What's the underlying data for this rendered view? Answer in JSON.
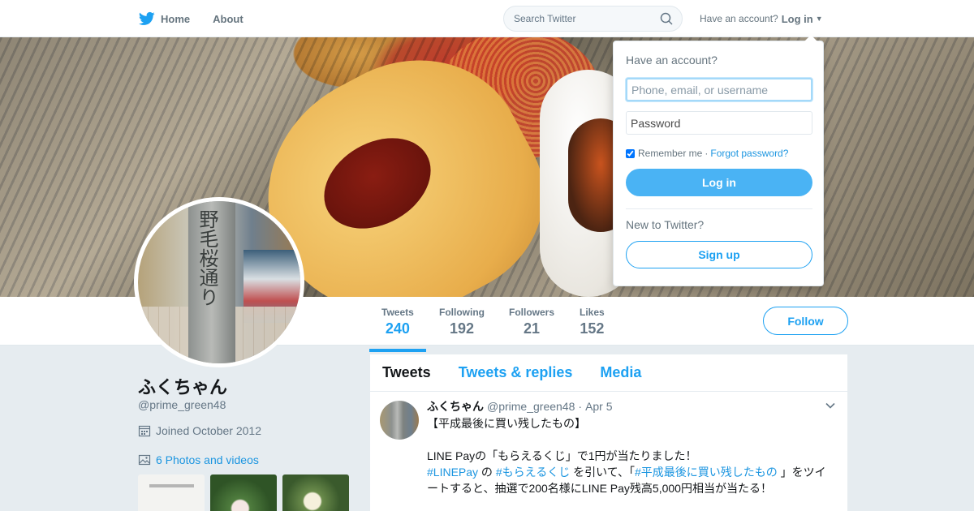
{
  "nav": {
    "home_label": "Home",
    "about_label": "About",
    "search_placeholder": "Search Twitter",
    "have_account_prompt": "Have an account?",
    "login_toggle_label": "Log in"
  },
  "colors": {
    "accent": "#1da1f2",
    "link": "#1b95e0",
    "login_button": "#4ab3f4",
    "background": "#e6ecf0"
  },
  "icons": {
    "brand": "twitter-bird-icon",
    "search": "search-icon",
    "caret": "caret-down-icon",
    "calendar": "calendar-icon",
    "photo": "photo-icon",
    "tweet_menu": "chevron-down-icon"
  },
  "login_dropdown": {
    "title": "Have an account?",
    "username_placeholder": "Phone, email, or username",
    "password_placeholder": "Password",
    "remember_label": "Remember me",
    "remember_checked": true,
    "separator": "·",
    "forgot_label": "Forgot password?",
    "login_button": "Log in",
    "new_prompt": "New to Twitter?",
    "signup_button": "Sign up"
  },
  "stats": [
    {
      "label": "Tweets",
      "value": "240",
      "active": true
    },
    {
      "label": "Following",
      "value": "192",
      "active": false
    },
    {
      "label": "Followers",
      "value": "21",
      "active": false
    },
    {
      "label": "Likes",
      "value": "152",
      "active": false
    }
  ],
  "follow_button": "Follow",
  "profile": {
    "name": "ふくちゃん",
    "handle": "@prime_green48",
    "joined": "Joined October 2012",
    "photos_link": "6 Photos and videos",
    "avatar_text": "野毛桜通り"
  },
  "tabs": [
    {
      "label": "Tweets",
      "active": true
    },
    {
      "label": "Tweets & replies",
      "active": false
    },
    {
      "label": "Media",
      "active": false
    }
  ],
  "tweet": {
    "name": "ふくちゃん",
    "handle": "@prime_green48",
    "separator": "·",
    "time": "Apr 5",
    "line1": "【平成最後に買い残したもの】",
    "line3": "LINE Payの「もらえるくじ」で1円が当たりました！",
    "line4_tag1": "#LINEPay",
    "line4_text1": " の ",
    "line4_tag2": "#もらえるくじ",
    "line4_text2": " を引いて、「",
    "line4_tag3": "#平成最後に買い残したもの",
    "line4_text3": " 」をツイ",
    "line5": "ートすると、抽選で200名様にLINE Pay残高5,000円相当が当たる！"
  }
}
